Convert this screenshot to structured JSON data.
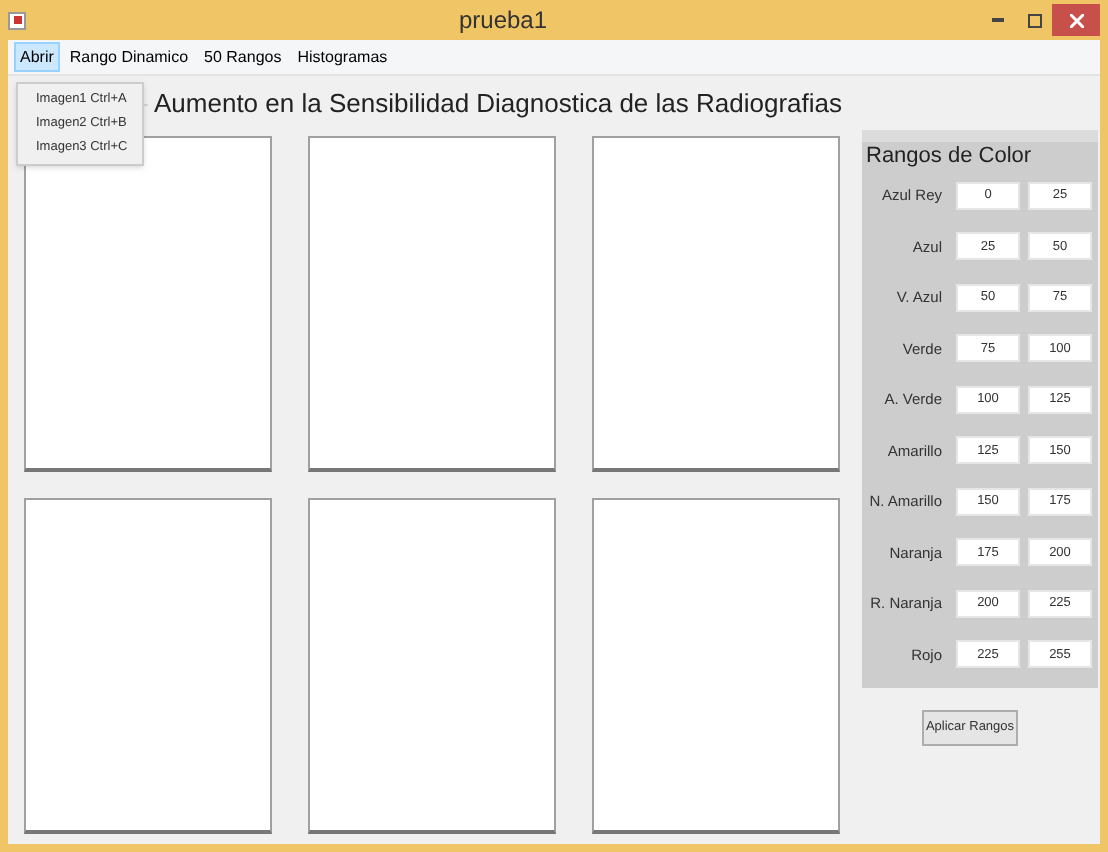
{
  "window": {
    "title": "prueba1"
  },
  "menu": [
    {
      "label": "Abrir",
      "selected": true
    },
    {
      "label": "Rango Dinamico",
      "selected": false
    },
    {
      "label": "50 Rangos",
      "selected": false
    },
    {
      "label": "Histogramas",
      "selected": false
    }
  ],
  "dropdown": [
    {
      "label": "Imagen1",
      "shortcut": "Ctrl+A"
    },
    {
      "label": "Imagen2",
      "shortcut": "Ctrl+B"
    },
    {
      "label": "Imagen3",
      "shortcut": "Ctrl+C"
    }
  ],
  "group_title": "Aumento en la Sensibilidad Diagnostica de las Radiografias",
  "ranges": {
    "title": "Rangos de Color",
    "rows": [
      {
        "name": "Azul Rey",
        "min": "0",
        "max": "25"
      },
      {
        "name": "Azul",
        "min": "25",
        "max": "50"
      },
      {
        "name": "V. Azul",
        "min": "50",
        "max": "75"
      },
      {
        "name": "Verde",
        "min": "75",
        "max": "100"
      },
      {
        "name": "A. Verde",
        "min": "100",
        "max": "125"
      },
      {
        "name": "Amarillo",
        "min": "125",
        "max": "150"
      },
      {
        "name": "N. Amarillo",
        "min": "150",
        "max": "175"
      },
      {
        "name": "Naranja",
        "min": "175",
        "max": "200"
      },
      {
        "name": "R. Naranja",
        "min": "200",
        "max": "225"
      },
      {
        "name": "Rojo",
        "min": "225",
        "max": "255"
      }
    ],
    "button": "Aplicar Rangos"
  }
}
